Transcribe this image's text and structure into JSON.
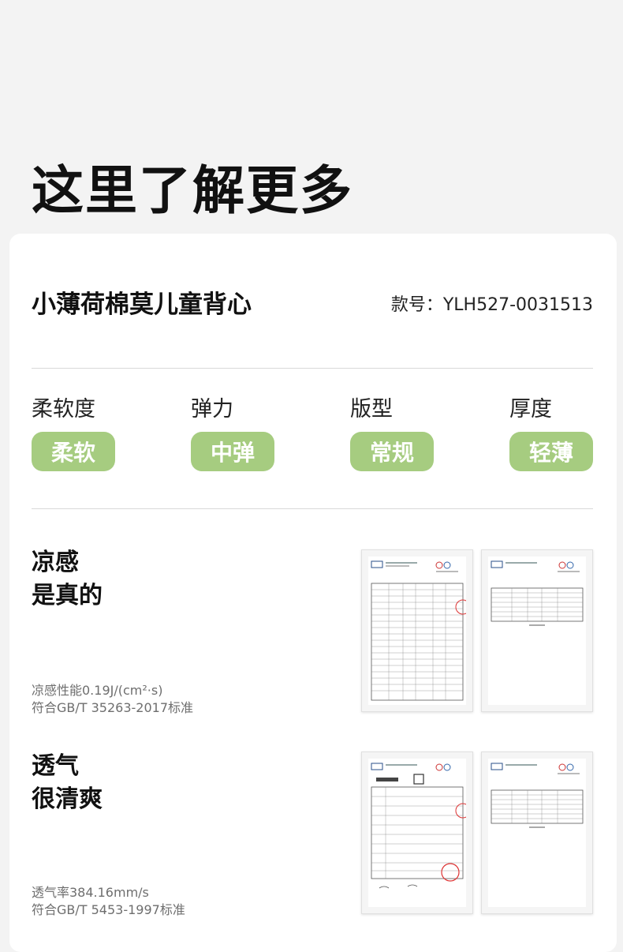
{
  "headline": "这里了解更多",
  "product": {
    "name": "小薄荷棉莫儿童背心",
    "style_code": "款号：YLH527-0031513"
  },
  "attributes": [
    {
      "label": "柔软度",
      "value": "柔软"
    },
    {
      "label": "弹力",
      "value": "中弹"
    },
    {
      "label": "版型",
      "value": "常规"
    },
    {
      "label": "厚度",
      "value": "轻薄"
    }
  ],
  "features": [
    {
      "title_line1": "凉感",
      "title_line2": "是真的",
      "note_line1": "凉感性能0.19J/(cm²·s)",
      "note_line2": "符合GB/T 35263-2017标准"
    },
    {
      "title_line1": "透气",
      "title_line2": "很清爽",
      "note_line1": "透气率384.16mm/s",
      "note_line2": "符合GB/T 5453-1997标准"
    }
  ],
  "colors": {
    "pill": "#a6cc80",
    "background": "#f3f3f3",
    "card": "#ffffff"
  }
}
